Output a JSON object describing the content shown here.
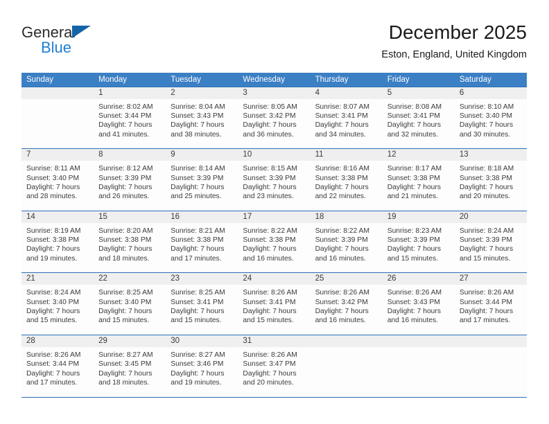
{
  "brand": {
    "line1": "General",
    "line2": "Blue",
    "logo_icon": "blue-triangle-icon"
  },
  "header": {
    "title": "December 2025",
    "location": "Eston, England, United Kingdom"
  },
  "colors": {
    "header_blue": "#3b7fc4",
    "rule_blue": "#2b6fb5",
    "number_strip": "#efefef",
    "brand_blue": "#1f7fd0",
    "triangle_blue": "#1464a8",
    "text": "#3a3a3a"
  },
  "weekdays": [
    "Sunday",
    "Monday",
    "Tuesday",
    "Wednesday",
    "Thursday",
    "Friday",
    "Saturday"
  ],
  "weeks": [
    {
      "days": [
        {
          "num": "",
          "lines": [
            "",
            "",
            "",
            ""
          ]
        },
        {
          "num": "1",
          "lines": [
            "Sunrise: 8:02 AM",
            "Sunset: 3:44 PM",
            "Daylight: 7 hours",
            "and 41 minutes."
          ]
        },
        {
          "num": "2",
          "lines": [
            "Sunrise: 8:04 AM",
            "Sunset: 3:43 PM",
            "Daylight: 7 hours",
            "and 38 minutes."
          ]
        },
        {
          "num": "3",
          "lines": [
            "Sunrise: 8:05 AM",
            "Sunset: 3:42 PM",
            "Daylight: 7 hours",
            "and 36 minutes."
          ]
        },
        {
          "num": "4",
          "lines": [
            "Sunrise: 8:07 AM",
            "Sunset: 3:41 PM",
            "Daylight: 7 hours",
            "and 34 minutes."
          ]
        },
        {
          "num": "5",
          "lines": [
            "Sunrise: 8:08 AM",
            "Sunset: 3:41 PM",
            "Daylight: 7 hours",
            "and 32 minutes."
          ]
        },
        {
          "num": "6",
          "lines": [
            "Sunrise: 8:10 AM",
            "Sunset: 3:40 PM",
            "Daylight: 7 hours",
            "and 30 minutes."
          ]
        }
      ]
    },
    {
      "days": [
        {
          "num": "7",
          "lines": [
            "Sunrise: 8:11 AM",
            "Sunset: 3:40 PM",
            "Daylight: 7 hours",
            "and 28 minutes."
          ]
        },
        {
          "num": "8",
          "lines": [
            "Sunrise: 8:12 AM",
            "Sunset: 3:39 PM",
            "Daylight: 7 hours",
            "and 26 minutes."
          ]
        },
        {
          "num": "9",
          "lines": [
            "Sunrise: 8:14 AM",
            "Sunset: 3:39 PM",
            "Daylight: 7 hours",
            "and 25 minutes."
          ]
        },
        {
          "num": "10",
          "lines": [
            "Sunrise: 8:15 AM",
            "Sunset: 3:39 PM",
            "Daylight: 7 hours",
            "and 23 minutes."
          ]
        },
        {
          "num": "11",
          "lines": [
            "Sunrise: 8:16 AM",
            "Sunset: 3:38 PM",
            "Daylight: 7 hours",
            "and 22 minutes."
          ]
        },
        {
          "num": "12",
          "lines": [
            "Sunrise: 8:17 AM",
            "Sunset: 3:38 PM",
            "Daylight: 7 hours",
            "and 21 minutes."
          ]
        },
        {
          "num": "13",
          "lines": [
            "Sunrise: 8:18 AM",
            "Sunset: 3:38 PM",
            "Daylight: 7 hours",
            "and 20 minutes."
          ]
        }
      ]
    },
    {
      "days": [
        {
          "num": "14",
          "lines": [
            "Sunrise: 8:19 AM",
            "Sunset: 3:38 PM",
            "Daylight: 7 hours",
            "and 19 minutes."
          ]
        },
        {
          "num": "15",
          "lines": [
            "Sunrise: 8:20 AM",
            "Sunset: 3:38 PM",
            "Daylight: 7 hours",
            "and 18 minutes."
          ]
        },
        {
          "num": "16",
          "lines": [
            "Sunrise: 8:21 AM",
            "Sunset: 3:38 PM",
            "Daylight: 7 hours",
            "and 17 minutes."
          ]
        },
        {
          "num": "17",
          "lines": [
            "Sunrise: 8:22 AM",
            "Sunset: 3:38 PM",
            "Daylight: 7 hours",
            "and 16 minutes."
          ]
        },
        {
          "num": "18",
          "lines": [
            "Sunrise: 8:22 AM",
            "Sunset: 3:39 PM",
            "Daylight: 7 hours",
            "and 16 minutes."
          ]
        },
        {
          "num": "19",
          "lines": [
            "Sunrise: 8:23 AM",
            "Sunset: 3:39 PM",
            "Daylight: 7 hours",
            "and 15 minutes."
          ]
        },
        {
          "num": "20",
          "lines": [
            "Sunrise: 8:24 AM",
            "Sunset: 3:39 PM",
            "Daylight: 7 hours",
            "and 15 minutes."
          ]
        }
      ]
    },
    {
      "days": [
        {
          "num": "21",
          "lines": [
            "Sunrise: 8:24 AM",
            "Sunset: 3:40 PM",
            "Daylight: 7 hours",
            "and 15 minutes."
          ]
        },
        {
          "num": "22",
          "lines": [
            "Sunrise: 8:25 AM",
            "Sunset: 3:40 PM",
            "Daylight: 7 hours",
            "and 15 minutes."
          ]
        },
        {
          "num": "23",
          "lines": [
            "Sunrise: 8:25 AM",
            "Sunset: 3:41 PM",
            "Daylight: 7 hours",
            "and 15 minutes."
          ]
        },
        {
          "num": "24",
          "lines": [
            "Sunrise: 8:26 AM",
            "Sunset: 3:41 PM",
            "Daylight: 7 hours",
            "and 15 minutes."
          ]
        },
        {
          "num": "25",
          "lines": [
            "Sunrise: 8:26 AM",
            "Sunset: 3:42 PM",
            "Daylight: 7 hours",
            "and 16 minutes."
          ]
        },
        {
          "num": "26",
          "lines": [
            "Sunrise: 8:26 AM",
            "Sunset: 3:43 PM",
            "Daylight: 7 hours",
            "and 16 minutes."
          ]
        },
        {
          "num": "27",
          "lines": [
            "Sunrise: 8:26 AM",
            "Sunset: 3:44 PM",
            "Daylight: 7 hours",
            "and 17 minutes."
          ]
        }
      ]
    },
    {
      "days": [
        {
          "num": "28",
          "lines": [
            "Sunrise: 8:26 AM",
            "Sunset: 3:44 PM",
            "Daylight: 7 hours",
            "and 17 minutes."
          ]
        },
        {
          "num": "29",
          "lines": [
            "Sunrise: 8:27 AM",
            "Sunset: 3:45 PM",
            "Daylight: 7 hours",
            "and 18 minutes."
          ]
        },
        {
          "num": "30",
          "lines": [
            "Sunrise: 8:27 AM",
            "Sunset: 3:46 PM",
            "Daylight: 7 hours",
            "and 19 minutes."
          ]
        },
        {
          "num": "31",
          "lines": [
            "Sunrise: 8:26 AM",
            "Sunset: 3:47 PM",
            "Daylight: 7 hours",
            "and 20 minutes."
          ]
        },
        {
          "num": "",
          "lines": [
            "",
            "",
            "",
            ""
          ]
        },
        {
          "num": "",
          "lines": [
            "",
            "",
            "",
            ""
          ]
        },
        {
          "num": "",
          "lines": [
            "",
            "",
            "",
            ""
          ]
        }
      ]
    }
  ]
}
